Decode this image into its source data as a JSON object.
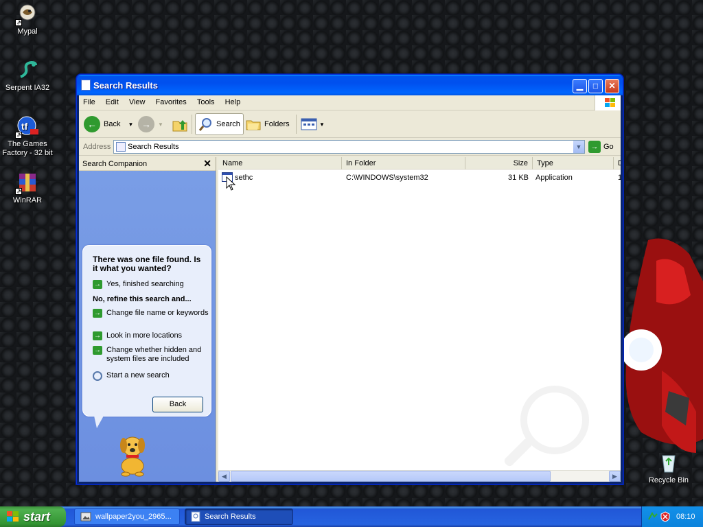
{
  "desktop": {
    "icons": [
      {
        "label": "Mypal"
      },
      {
        "label": "Serpent IA32"
      },
      {
        "label": "The Games Factory - 32 bit"
      },
      {
        "label": "WinRAR"
      },
      {
        "label": "Recycle Bin"
      }
    ]
  },
  "window": {
    "title": "Search Results",
    "menu": [
      "File",
      "Edit",
      "View",
      "Favorites",
      "Tools",
      "Help"
    ],
    "toolbar": {
      "back_label": "Back",
      "search_label": "Search",
      "folders_label": "Folders"
    },
    "address": {
      "label": "Address",
      "value": "Search Results",
      "go_label": "Go"
    },
    "companion": {
      "title": "Search Companion",
      "question": "There was one file found.  Is it what you wanted?",
      "yes_option": "Yes, finished searching",
      "refine_heading": "No, refine this search and...",
      "options": [
        "Change file name or keywords",
        "Look in more locations",
        "Change whether hidden and system files are included"
      ],
      "new_search": "Start a new search",
      "back_button": "Back"
    },
    "results": {
      "columns": [
        "Name",
        "In Folder",
        "Size",
        "Type",
        "D"
      ],
      "rows": [
        {
          "name": "sethc",
          "folder": "C:\\WINDOWS\\system32",
          "size": "31 KB",
          "type": "Application",
          "date": "1"
        }
      ]
    }
  },
  "taskbar": {
    "start_label": "start",
    "tasks": [
      {
        "label": "wallpaper2you_2965..."
      },
      {
        "label": "Search Results"
      }
    ],
    "clock": "08:10"
  },
  "colors": {
    "title_bar": "#0053ee",
    "taskbar": "#2663e0",
    "start_button": "#3c9a3c",
    "companion_pane": "#6c8fe0",
    "window_face": "#ece9d8"
  }
}
